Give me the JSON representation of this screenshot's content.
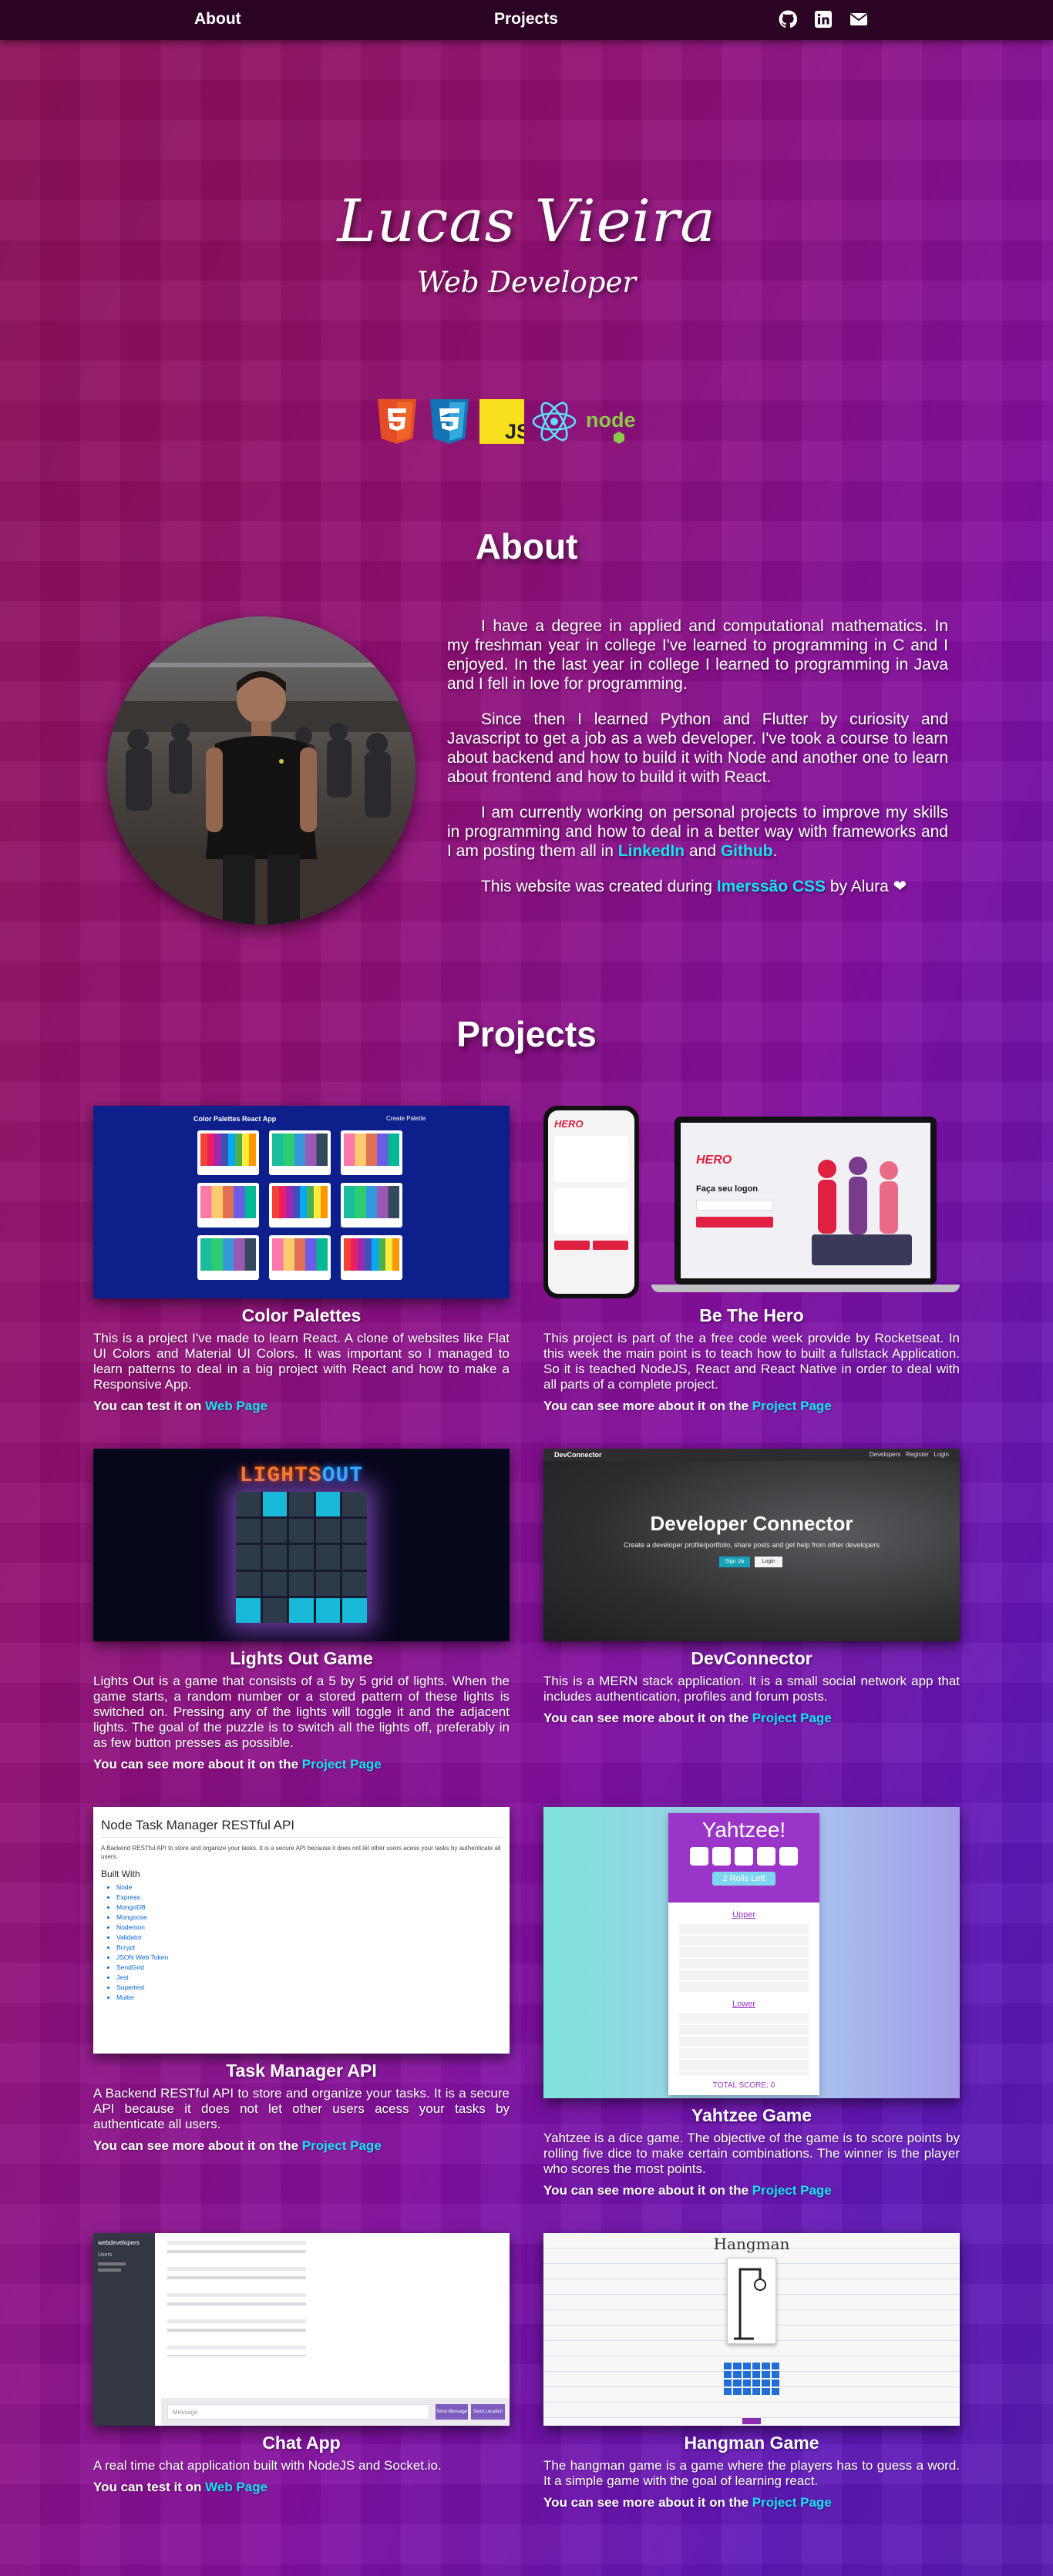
{
  "nav": {
    "about": "About",
    "projects": "Projects",
    "icons": [
      "github-icon",
      "linkedin-icon",
      "envelope-icon"
    ]
  },
  "hero": {
    "name": "Lucas Vieira",
    "role": "Web Developer",
    "tech_icons": [
      "html5-icon",
      "css3-icon",
      "js-icon",
      "react-icon",
      "nodejs-icon"
    ],
    "tech_js_label": "JS",
    "tech_node_label": "node"
  },
  "about": {
    "title": "About",
    "p1": "I have a degree in applied and computational mathematics. In my freshman year in college I've learned to programming in C and I enjoyed. In the last year in college I learned to programming in Java and I fell in love for programming.",
    "p2": "Since then I learned Python and Flutter by curiosity and Javascript to get a job as a web developer. I've took a course to learn about backend and how to build it with Node and another one to learn about frontend and how to build it with React.",
    "p3_start": "I am currently working on personal projects to improve my skills in programming and how to deal in a better way with frameworks and I am posting them all in ",
    "p3_link1": "LinkedIn",
    "p3_mid": " and ",
    "p3_link2": "Github",
    "p3_end": ".",
    "p4_start": "This website was created during ",
    "p4_link": "Imerssão CSS",
    "p4_end": " by Alura ❤"
  },
  "projects": {
    "title": "Projects",
    "items": [
      {
        "title": "Color Palettes",
        "desc": "This is a project I've made to learn React. A clone of websites like Flat UI Colors and Material UI Colors. It was important so I managed to learn patterns to deal in a big project with React and how to make a Responsive App.",
        "link_prefix": "You can test it on ",
        "link_text": "Web Page",
        "shot_title": "Color Palettes React App",
        "shot_action": "Create Palette"
      },
      {
        "title": "Be The Hero",
        "desc": "This project is part of the a free code week provide by Rocketseat. In this week the main point is to teach how to built a fullstack Application. So it is teached NodeJS, React and React Native in order to deal with all parts of a complete project.",
        "link_prefix": "You can see more about it on the ",
        "link_text": "Project Page",
        "shot_logo": "HERO",
        "shot_heading": "Faça seu logon"
      },
      {
        "title": "Lights Out Game",
        "desc": "Lights Out is a game that consists of a 5 by 5 grid of lights. When the game starts, a random number or a stored pattern of these lights is switched on. Pressing any of the lights will toggle it and the adjacent lights. The goal of the puzzle is to switch all the lights off, preferably in as few button presses as possible.",
        "link_prefix": "You can see more about it on the ",
        "link_text": "Project Page",
        "shot_title_a": "LIGHTS",
        "shot_title_b": "OUT"
      },
      {
        "title": "DevConnector",
        "desc": "This is a MERN stack application. It is a small social network app that includes authentication, profiles and forum posts.",
        "link_prefix": "You can see more about it on the ",
        "link_text": "Project Page",
        "shot_brand": "DevConnector",
        "shot_nav": "Developers   Register   Login",
        "shot_heading": "Developer Connector",
        "shot_sub": "Create a developer profile/portfolio, share posts and get help from other developers",
        "shot_btn1": "Sign Up",
        "shot_btn2": "Login"
      },
      {
        "title": "Task Manager API",
        "desc": "A Backend RESTful API to store and organize your tasks. It is a secure API because it does not let other users acess your tasks by authenticate all users.",
        "link_prefix": "You can see more about it on the ",
        "link_text": "Project Page",
        "shot_heading": "Node Task Manager RESTful API",
        "shot_text": "A Backend RESTful API to store and organize your tasks. It is a secure API because it does not let other users acess your tasks by authenticate all users.",
        "shot_built": "Built With",
        "shot_list": [
          "Node",
          "Express",
          "MongoDB",
          "Mongoose",
          "Nodemon",
          "Validator",
          "Bcrypt",
          "JSON Web Token",
          "SendGrid",
          "Jest",
          "Supertest",
          "Multer"
        ]
      },
      {
        "title": "Yahtzee Game",
        "desc": "Yahtzee is a dice game. The objective of the game is to score points by rolling five dice to make certain combinations. The winner is the player who scores the most points.",
        "link_prefix": "You can see more about it on the ",
        "link_text": "Project Page",
        "shot_heading": "Yahtzee!",
        "shot_rolls": "2 Rolls Left",
        "shot_upper": "Upper",
        "shot_lower": "Lower",
        "shot_total": "TOTAL SCORE: 0"
      },
      {
        "title": "Chat App",
        "desc": "A real time chat application built with NodeJS and Socket.io.",
        "link_prefix": "You can test it on ",
        "link_text": "Web Page",
        "shot_room": "webdevelopers",
        "shot_users": "Users",
        "shot_input": "Message",
        "shot_btn1": "Send Message",
        "shot_btn2": "Send Location"
      },
      {
        "title": "Hangman Game",
        "desc": "The hangman game is a game where the players has to guess a word. It a simple game with the goal of learning react.",
        "link_prefix": "You can see more about it on the ",
        "link_text": "Project Page",
        "shot_heading": "Hangman"
      }
    ]
  },
  "colors": {
    "accent": "#19e3f0",
    "nav_bg": "#2b0425"
  }
}
